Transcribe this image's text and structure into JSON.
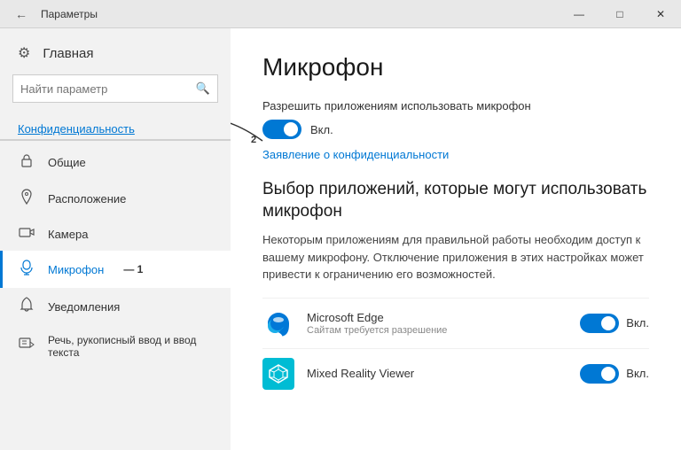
{
  "titlebar": {
    "title": "Параметры",
    "back_label": "←",
    "minimize": "—",
    "maximize": "□",
    "close": "✕"
  },
  "sidebar": {
    "home_label": "Главная",
    "search_placeholder": "Найти параметр",
    "section_header": "Конфиденциальность",
    "items": [
      {
        "id": "general",
        "label": "Общие",
        "icon": "🔒"
      },
      {
        "id": "location",
        "label": "Расположение",
        "icon": "📍"
      },
      {
        "id": "camera",
        "label": "Камера",
        "icon": "📷"
      },
      {
        "id": "microphone",
        "label": "Микрофон",
        "icon": "🎤",
        "active": true
      },
      {
        "id": "notifications",
        "label": "Уведомления",
        "icon": "🔔"
      },
      {
        "id": "speech",
        "label": "Речь, рукописный ввод и ввод текста",
        "icon": "📝"
      }
    ]
  },
  "content": {
    "page_title": "Микрофон",
    "permission_text": "Разрешить приложениям использовать микрофон",
    "toggle_main_on_label": "Вкл.",
    "privacy_link_text": "Заявление о конфиденциальности",
    "section_subtitle": "Выбор приложений, которые могут использовать микрофон",
    "section_desc": "Некоторым приложениям для правильной работы необходим доступ к вашему микрофону. Отключение приложения в этих настройках может привести к ограничению его возможностей.",
    "annotation_1": "1",
    "annotation_2": "2",
    "apps": [
      {
        "id": "edge",
        "name": "Microsoft Edge",
        "sub": "Сайтам требуется разрешение",
        "on_label": "Вкл.",
        "enabled": true
      },
      {
        "id": "mixed-reality",
        "name": "Mixed Reality Viewer",
        "sub": "",
        "on_label": "Вкл.",
        "enabled": true
      }
    ]
  }
}
